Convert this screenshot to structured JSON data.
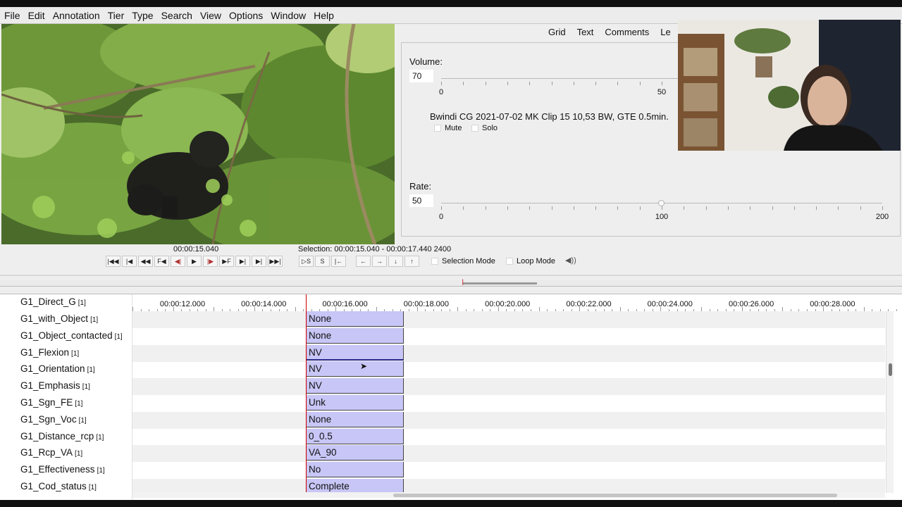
{
  "menubar": {
    "items": [
      "File",
      "Edit",
      "Annotation",
      "Tier",
      "Type",
      "Search",
      "View",
      "Options",
      "Window",
      "Help"
    ]
  },
  "tabs": [
    "Grid",
    "Text",
    "Comments",
    "Le"
  ],
  "volume": {
    "label": "Volume:",
    "value": "70",
    "level": 70,
    "ticks": [
      "0",
      "50"
    ]
  },
  "media": {
    "filename": "Bwindi CG 2021-07-02 MK Clip 15 10,53 BW, GTE 0.5min.",
    "mute_label": "Mute",
    "solo_label": "Solo"
  },
  "rate": {
    "label": "Rate:",
    "value": "50",
    "level": 100,
    "ticks": [
      "0",
      "100",
      "200"
    ]
  },
  "player": {
    "current_time": "00:00:15.040",
    "selection": "Selection: 00:00:15.040 - 00:00:17.440  2400",
    "selection_mode_label": "Selection Mode",
    "loop_mode_label": "Loop Mode"
  },
  "timeline": {
    "ruler": [
      "00:00:12.000",
      "00:00:14.000",
      "00:00:16.000",
      "00:00:18.000",
      "00:00:20.000",
      "00:00:22.000",
      "00:00:24.000",
      "00:00:26.000",
      "00:00:28.000"
    ],
    "tiers": [
      {
        "name": "G1_Direct_G",
        "count": "[1]",
        "value": ""
      },
      {
        "name": "G1_with_Object",
        "count": "[1]",
        "value": "None"
      },
      {
        "name": "G1_Object_contacted",
        "count": "[1]",
        "value": "None"
      },
      {
        "name": "G1_Flexion",
        "count": "[1]",
        "value": "NV"
      },
      {
        "name": "G1_Orientation",
        "count": "[1]",
        "value": "NV"
      },
      {
        "name": "G1_Emphasis",
        "count": "[1]",
        "value": "NV"
      },
      {
        "name": "G1_Sgn_FE",
        "count": "[1]",
        "value": "Unk"
      },
      {
        "name": "G1_Sgn_Voc",
        "count": "[1]",
        "value": "None"
      },
      {
        "name": "G1_Distance_rcp",
        "count": "[1]",
        "value": "0_0.5"
      },
      {
        "name": "G1_Rcp_VA",
        "count": "[1]",
        "value": "VA_90"
      },
      {
        "name": "G1_Effectiveness",
        "count": "[1]",
        "value": "No"
      },
      {
        "name": "G1_Cod_status",
        "count": "[1]",
        "value": "Complete"
      }
    ]
  },
  "colors": {
    "annotation_fill": "#c7c6f6",
    "cursor": "#cc0000",
    "panel_bg": "#eeeeee"
  },
  "icons": {
    "player_controls": [
      "first-frame-icon",
      "prev-second-icon",
      "prev-frame-10-icon",
      "prev-frame-icon",
      "prev-f-icon",
      "prev-frame-red-icon",
      "play-icon",
      "next-frame-red-icon",
      "next-f-icon",
      "next-frame-icon",
      "next-second-icon",
      "last-frame-icon"
    ]
  }
}
